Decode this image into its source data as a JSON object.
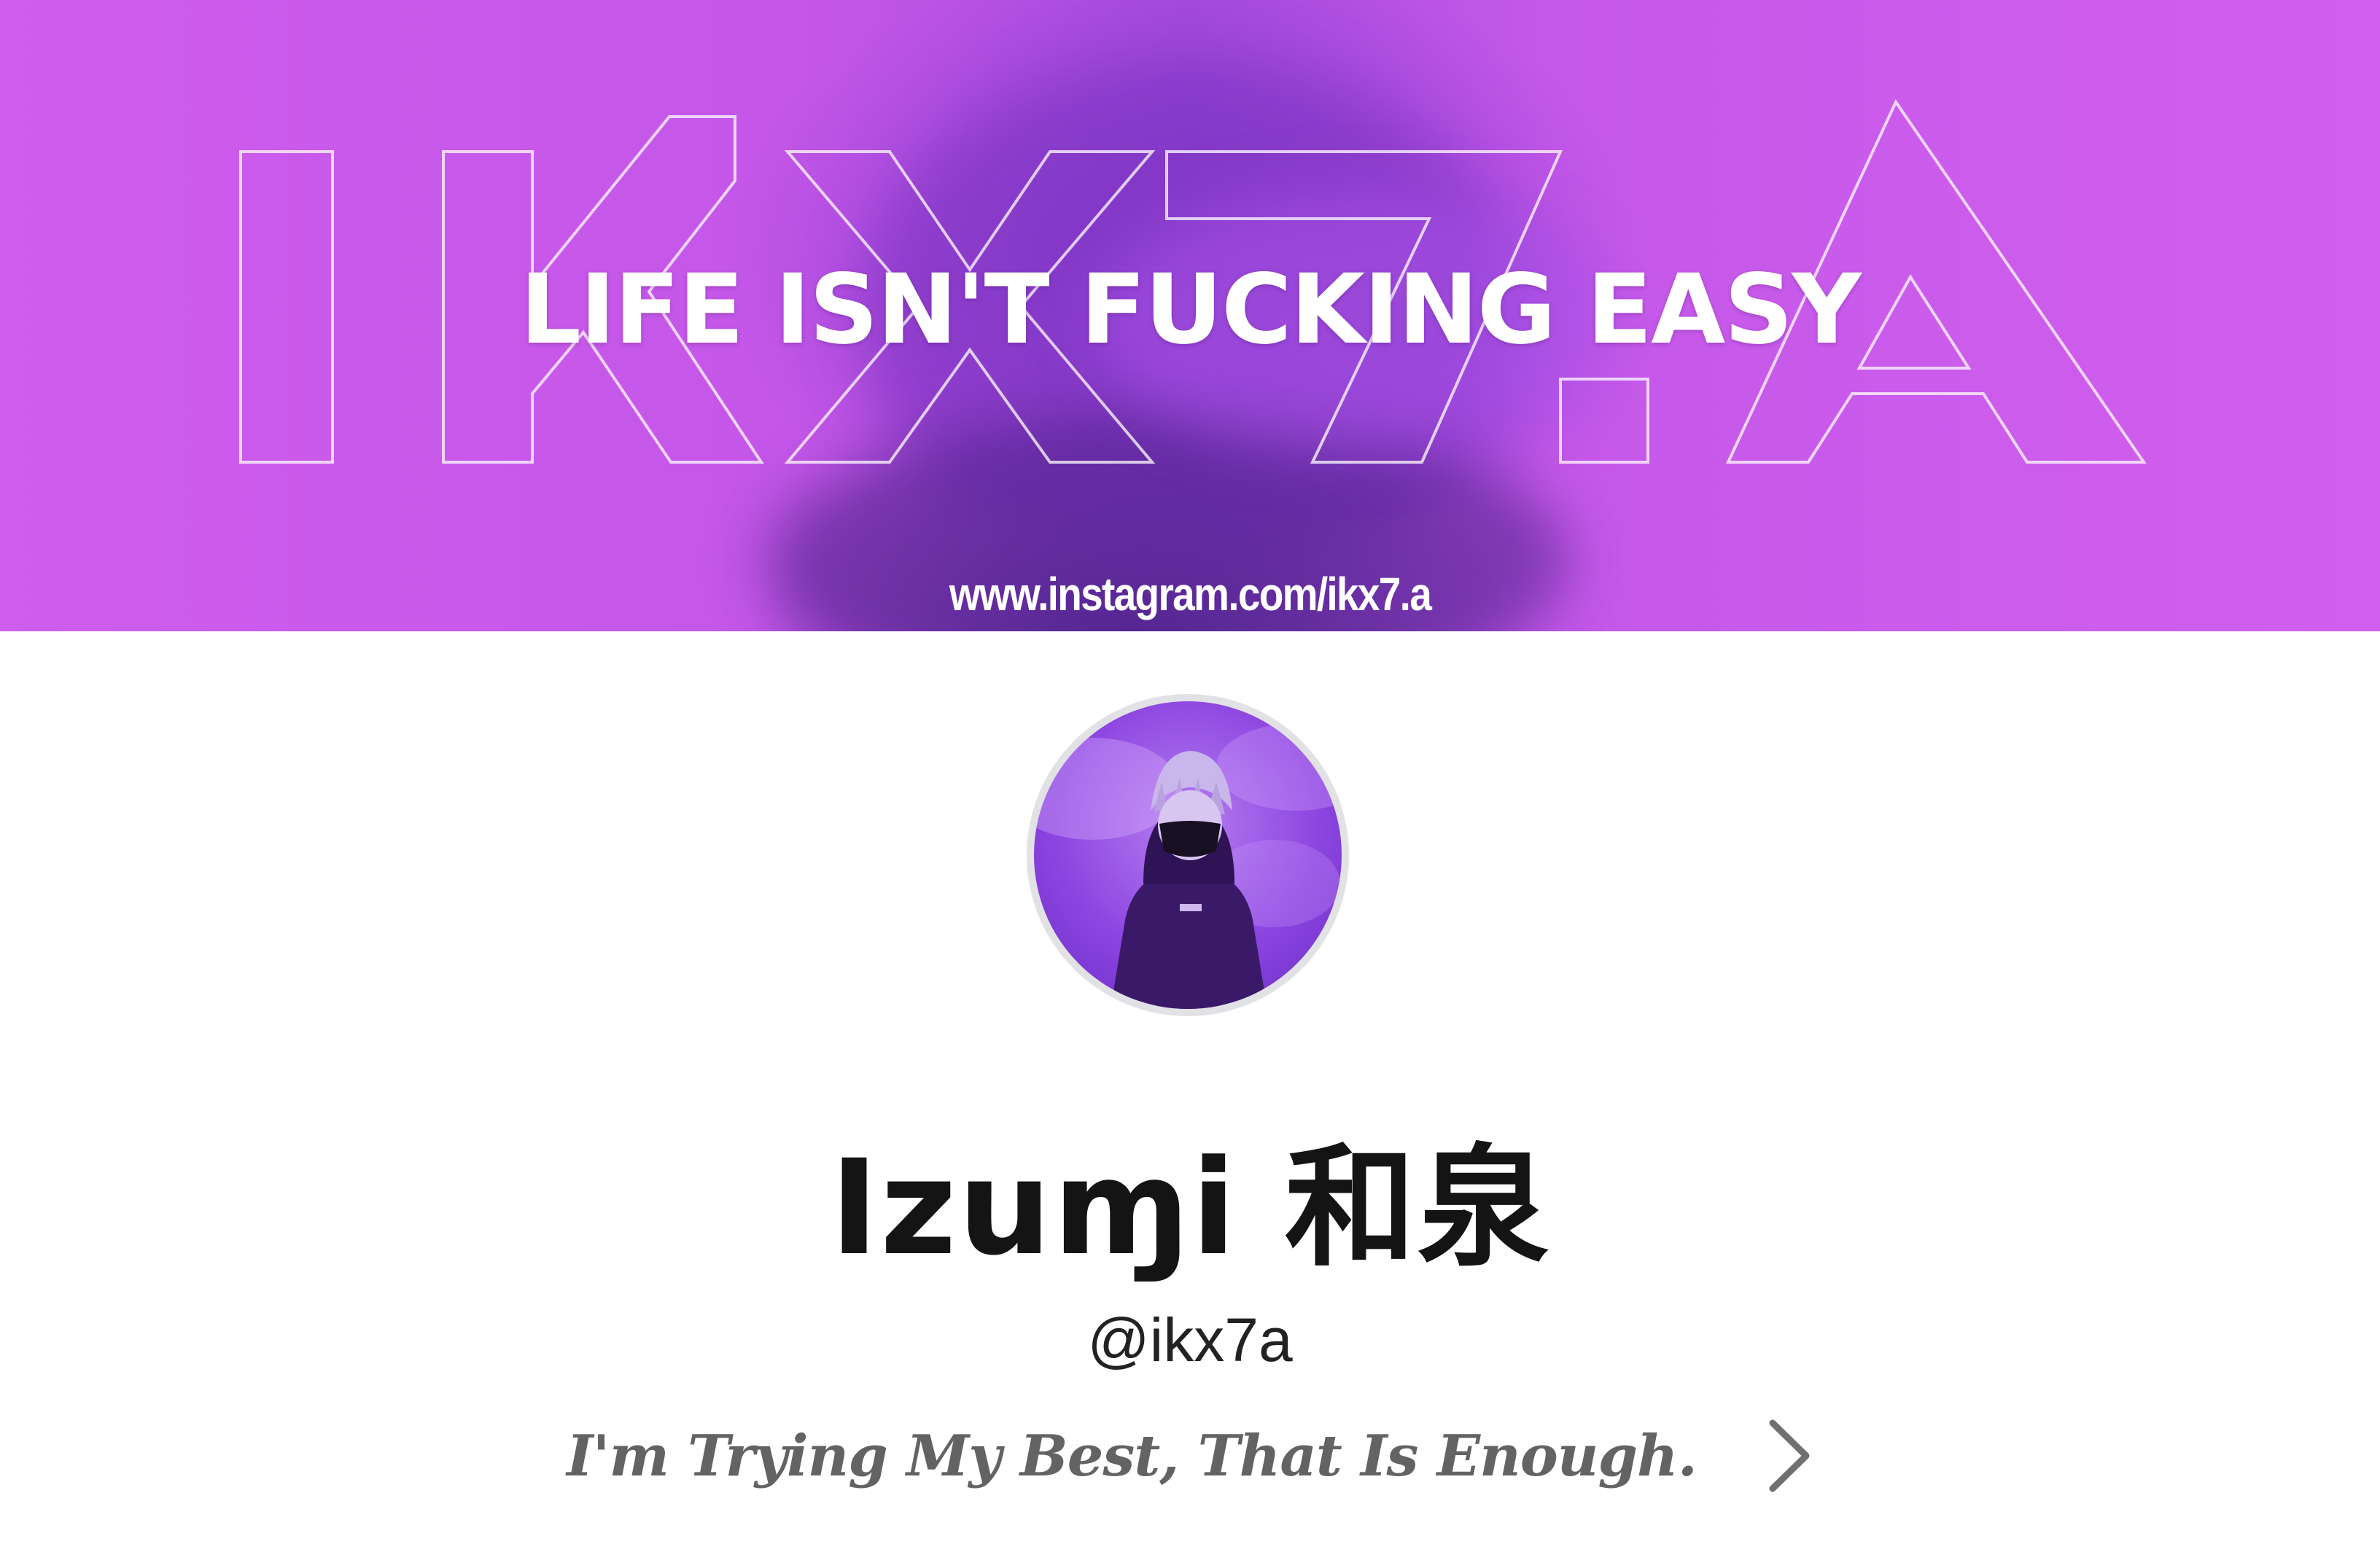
{
  "banner": {
    "watermark": "IKX7.A",
    "headline": "LIFE ISN'T FUCKING EASY",
    "url": "www.instagram.com/ikx7.a",
    "colors": {
      "base": "#c356e8",
      "shadow": "#5a2c9a",
      "text": "#ffffff"
    }
  },
  "profile": {
    "display_name": "Izuɱi 和泉",
    "handle": "@ikx7a",
    "bio": "I'm Trying My Best, That Is Enough.",
    "chevron_icon": "chevron-right-icon",
    "colors": {
      "name": "#141414",
      "bio": "#636363",
      "avatar_bg": "#8c45e0"
    }
  }
}
